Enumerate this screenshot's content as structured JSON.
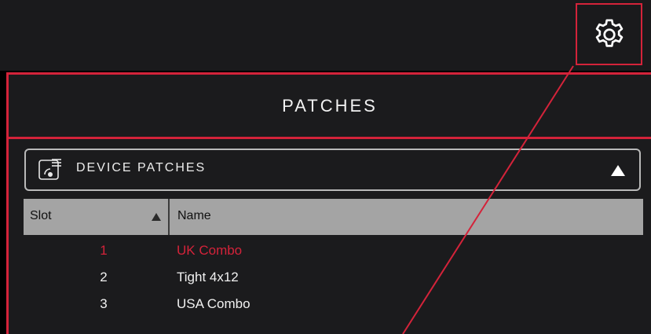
{
  "settings": {
    "icon": "gear-icon"
  },
  "panel": {
    "title": "PATCHES",
    "dropdown": {
      "label": "DEVICE PATCHES",
      "icon": "device-patches-icon",
      "arrow": "collapse-arrow-icon"
    }
  },
  "table": {
    "columns": {
      "slot": "Slot",
      "name": "Name"
    },
    "rows": [
      {
        "slot": "1",
        "name": "UK Combo",
        "selected": true
      },
      {
        "slot": "2",
        "name": "Tight 4x12",
        "selected": false
      },
      {
        "slot": "3",
        "name": "USA Combo",
        "selected": false
      }
    ]
  },
  "colors": {
    "accent": "#d4233a",
    "background": "#1b1b1d",
    "header": "#a4a4a4",
    "text": "#f1f1f1"
  }
}
